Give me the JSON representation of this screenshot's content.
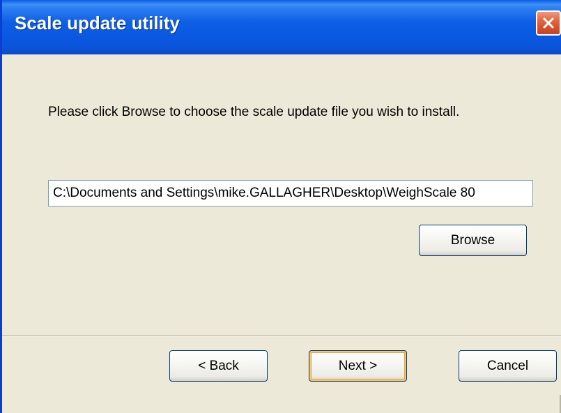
{
  "window": {
    "title": "Scale update utility",
    "close_icon": "close-icon"
  },
  "content": {
    "instruction": "Please click Browse to choose the scale update file you wish to install.",
    "file_path": {
      "value": "C:\\Documents and Settings\\mike.GALLAGHER\\Desktop\\WeighScale 80"
    },
    "browse_label": "Browse"
  },
  "footer": {
    "back_label": "< Back",
    "next_label": "Next >",
    "cancel_label": "Cancel"
  },
  "colors": {
    "titlebar": "#0a57e0",
    "face": "#ece9d8",
    "close": "#d8502a",
    "default_button_focus": "#f9c56a"
  }
}
